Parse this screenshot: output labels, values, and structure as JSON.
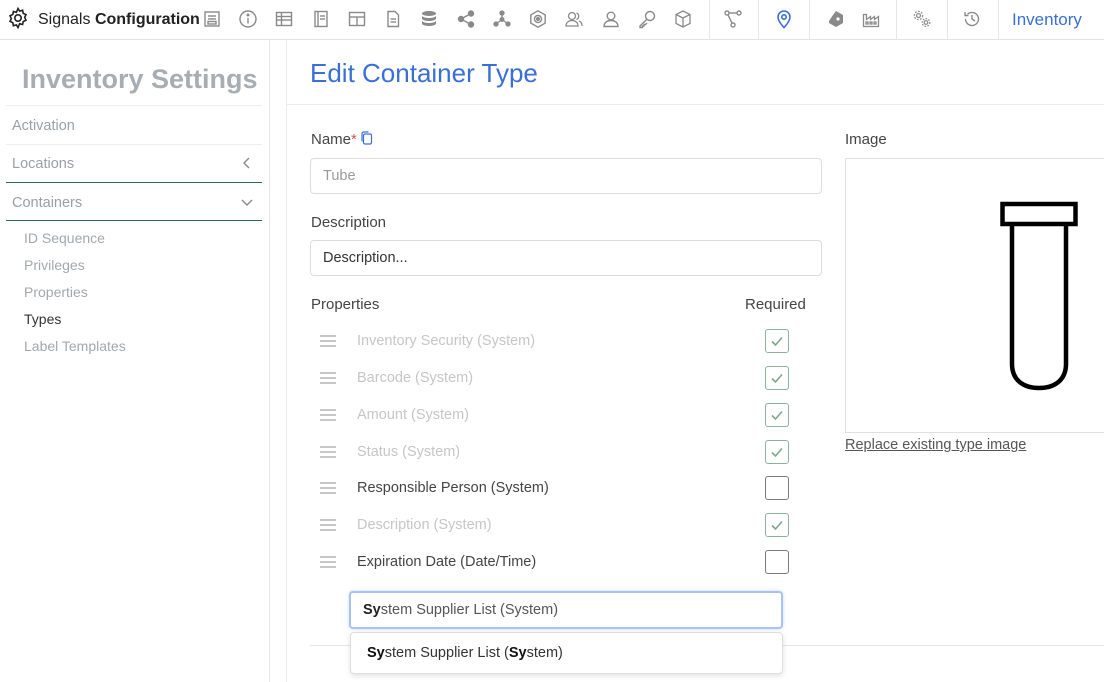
{
  "app": {
    "name_prefix": "Signals",
    "name_bold": "Configuration",
    "context_link": "Inventory"
  },
  "toolbar_icons": [
    "gear-icon",
    "form-icon",
    "info-icon",
    "table-icon",
    "notebook-icon",
    "grid-icon",
    "document-icon",
    "database-icon",
    "share-icon",
    "network-icon",
    "target-icon",
    "users-icon",
    "user-icon",
    "key-icon",
    "cube-icon",
    "workflow-icon",
    "location-pin-icon",
    "flask-icon",
    "factory-icon",
    "settings-gears-icon",
    "history-icon"
  ],
  "sidebar": {
    "title": "Inventory Settings",
    "items": [
      {
        "label": "Activation"
      },
      {
        "label": "Locations"
      },
      {
        "label": "Containers"
      }
    ],
    "sub_items": [
      {
        "label": "ID Sequence"
      },
      {
        "label": "Privileges"
      },
      {
        "label": "Properties"
      },
      {
        "label": "Types"
      },
      {
        "label": "Label Templates"
      }
    ]
  },
  "main": {
    "title": "Edit Container Type",
    "name_label": "Name",
    "name_required_mark": "*",
    "name_placeholder": "Tube",
    "description_label": "Description",
    "description_placeholder": "Description...",
    "properties_label": "Properties",
    "required_label": "Required",
    "properties": [
      {
        "name": "Inventory Security (System)",
        "required": true,
        "enabled": false
      },
      {
        "name": "Barcode (System)",
        "required": true,
        "enabled": false
      },
      {
        "name": "Amount (System)",
        "required": true,
        "enabled": false
      },
      {
        "name": "Status (System)",
        "required": true,
        "enabled": false
      },
      {
        "name": "Responsible Person (System)",
        "required": false,
        "enabled": true
      },
      {
        "name": "Description (System)",
        "required": true,
        "enabled": false
      },
      {
        "name": "Expiration Date (Date/Time)",
        "required": false,
        "enabled": true
      }
    ],
    "add_property": {
      "typed": "Sy",
      "rest": "stem Supplier List (System)"
    },
    "suggestion": {
      "part1_bold": "Sy",
      "part2": "stem Supplier List (",
      "part3_bold": "Sy",
      "part4": "stem)"
    },
    "image_label": "Image",
    "replace_image_link": "Replace existing type image"
  },
  "colors": {
    "accent": "#3a6fd8",
    "sidebar_active_line": "#2f6b46",
    "check_green": "#8fb39a"
  }
}
